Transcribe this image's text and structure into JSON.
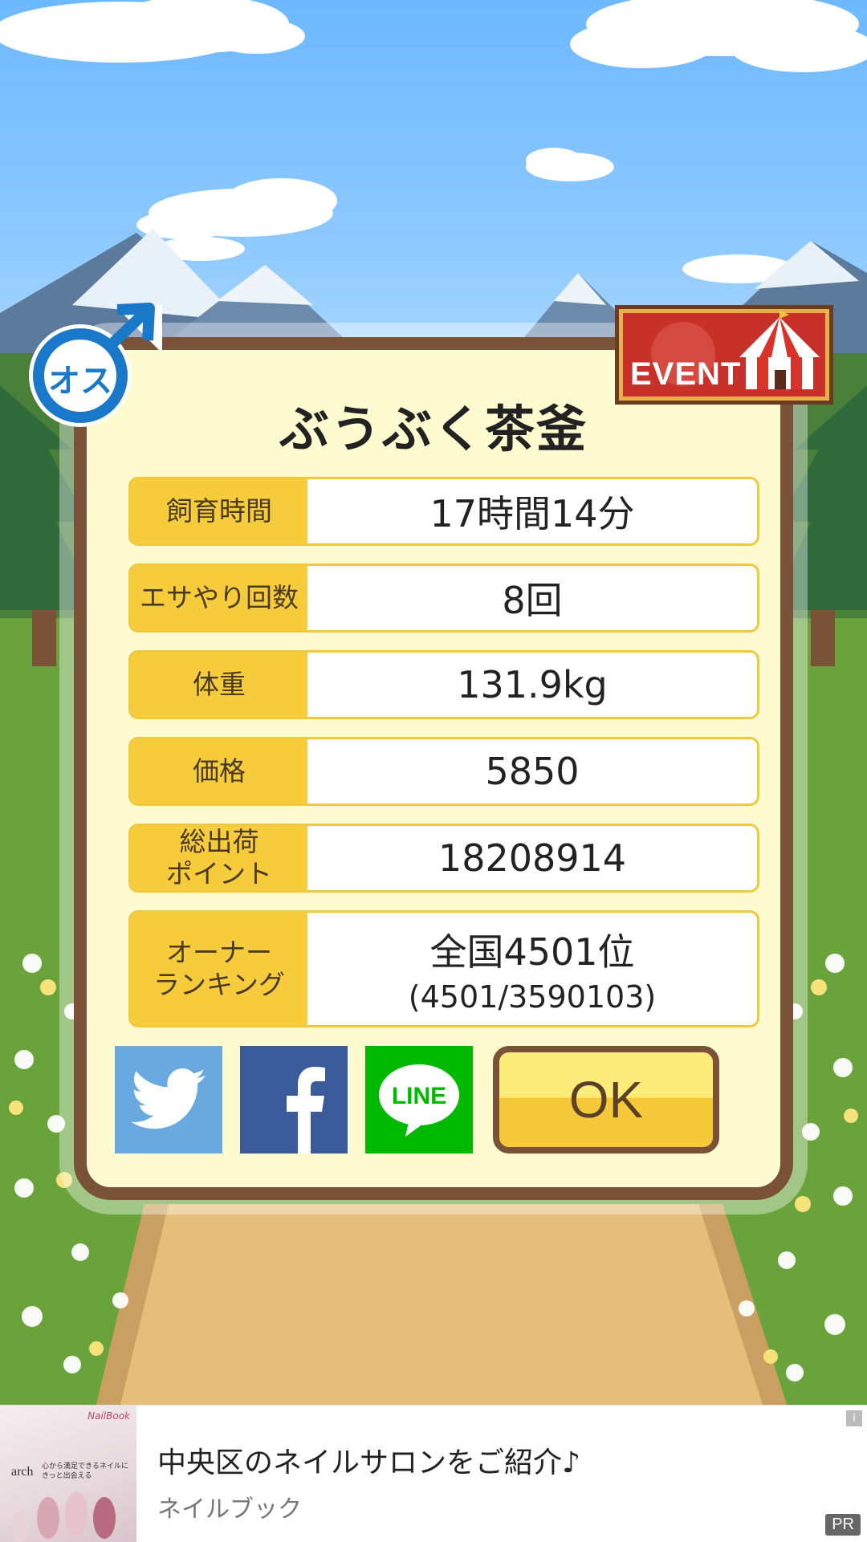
{
  "title": "ぶうぶく茶釜",
  "gender_icon": {
    "label": "オス",
    "icon": "male-symbol-icon",
    "color": "#1a78c8"
  },
  "event_badge": {
    "label": "EVENT",
    "icon": "circus-tent-icon",
    "color": "#c8302a"
  },
  "stats": [
    {
      "label": "飼育時間",
      "value": "17時間14分"
    },
    {
      "label": "エサやり回数",
      "value": "8回"
    },
    {
      "label": "体重",
      "value": "131.9kg"
    },
    {
      "label": "価格",
      "value": "5850"
    },
    {
      "label": "総出荷\nポイント",
      "value": "18208914"
    },
    {
      "label": "オーナー\nランキング",
      "value": "全国4501位",
      "subvalue": "(4501/3590103)"
    }
  ],
  "share": [
    {
      "name": "twitter",
      "icon": "twitter-bird-icon",
      "color": "#6aa9e0"
    },
    {
      "name": "facebook",
      "icon": "facebook-f-icon",
      "color": "#3b5a99"
    },
    {
      "name": "line",
      "icon": "line-bubble-icon",
      "label": "LINE",
      "color": "#00b900"
    }
  ],
  "ok_label": "OK",
  "ad": {
    "headline": "中央区のネイルサロンをご紹介♪",
    "source": "ネイルブック",
    "thumb_brand": "arch",
    "thumb_copy": "心から満足できるネイルにきっと出会える",
    "thumb_logo": "NailBook",
    "info": "i",
    "pr": "PR"
  }
}
